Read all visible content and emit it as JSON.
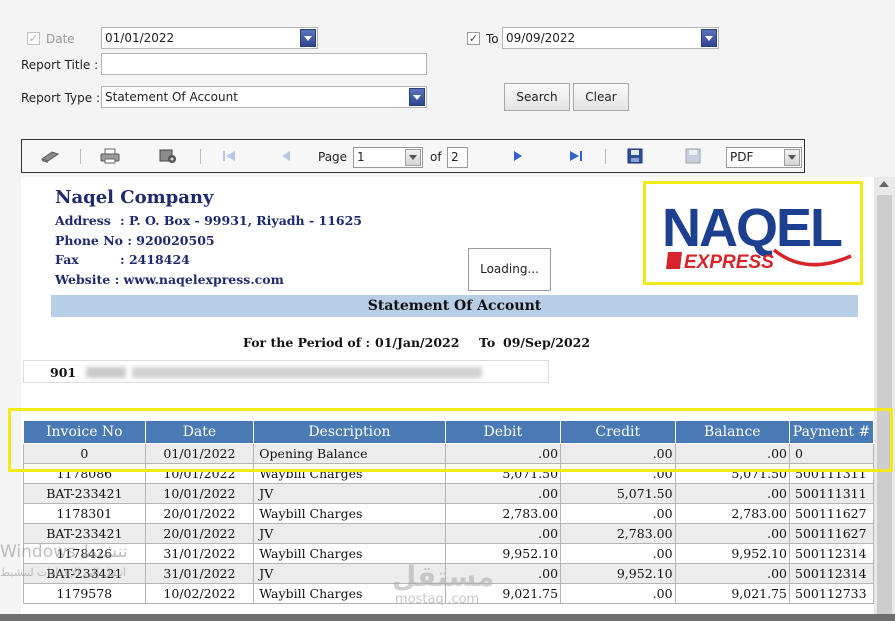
{
  "form": {
    "date_label": "Date",
    "date_value": "01/01/2022",
    "to_label": "To",
    "to_value": "09/09/2022",
    "report_title_label": "Report Title :",
    "report_title_value": "",
    "report_type_label": "Report Type :",
    "report_type_value": "Statement Of Account",
    "search_label": "Search",
    "clear_label": "Clear"
  },
  "toolbar": {
    "icons": [
      "refresh-icon",
      "print-icon",
      "print-setup-icon",
      "first-page-icon",
      "prev-page-icon",
      "next-page-icon",
      "last-page-icon",
      "save-icon",
      "export-icon"
    ],
    "page_label": "Page",
    "page_value": "1",
    "of_label": "of",
    "total_pages": "2",
    "export_format": "PDF"
  },
  "report": {
    "company_name": "Naqel Company",
    "address_label": "Address",
    "address_value": ": P. O. Box - 99931, Riyadh - 11625",
    "phone_label": "Phone No",
    "phone_value": ": 920020505",
    "fax_label": "Fax",
    "fax_value": ": 2418424",
    "website_label": "Website",
    "website_value": ": www.naqelexpress.com",
    "logo_text_main": "NAQEL",
    "logo_text_sub": "EXPRESS",
    "loading_text": "Loading...",
    "title": "Statement Of Account",
    "period_label": "For the Period of :",
    "period_from": "01/Jan/2022",
    "period_to_label": "To",
    "period_to": "09/Sep/2022",
    "account_no_prefix": "901",
    "columns": [
      "Invoice No",
      "Date",
      "Description",
      "Debit",
      "Credit",
      "Balance",
      "Payment #"
    ],
    "rows": [
      [
        "0",
        "01/01/2022",
        "Opening Balance",
        ".00",
        ".00",
        ".00",
        "0"
      ],
      [
        "1178086",
        "10/01/2022",
        "Waybill Charges",
        "5,071.50",
        ".00",
        "5,071.50",
        "500111311"
      ],
      [
        "BAT-233421",
        "10/01/2022",
        "JV",
        ".00",
        "5,071.50",
        ".00",
        "500111311"
      ],
      [
        "1178301",
        "20/01/2022",
        "Waybill Charges",
        "2,783.00",
        ".00",
        "2,783.00",
        "500111627"
      ],
      [
        "BAT-233421",
        "20/01/2022",
        "JV",
        ".00",
        "2,783.00",
        ".00",
        "500111627"
      ],
      [
        "1178426",
        "31/01/2022",
        "Waybill Charges",
        "9,952.10",
        ".00",
        "9,952.10",
        "500112314"
      ],
      [
        "BAT-233421",
        "31/01/2022",
        "JV",
        ".00",
        "9,952.10",
        ".00",
        "500112314"
      ],
      [
        "1179578",
        "10/02/2022",
        "Waybill Charges",
        "9,021.75",
        ".00",
        "9,021.75",
        "500112733"
      ]
    ]
  },
  "overlays": {
    "watermark_text": "مستقل",
    "watermark_sub": "mostaql.com",
    "windows_text": "Windows تنشيط",
    "windows_sub": "انتقل إلى الإعدادات لتنشيط"
  },
  "colors": {
    "header_blue": "#4a7ab5",
    "title_bar": "#b8cde6",
    "highlight_yellow": "#f2ea16",
    "company_navy": "#1f2a6e",
    "logo_navy": "#1d3f8f",
    "logo_red": "#d8232a"
  }
}
